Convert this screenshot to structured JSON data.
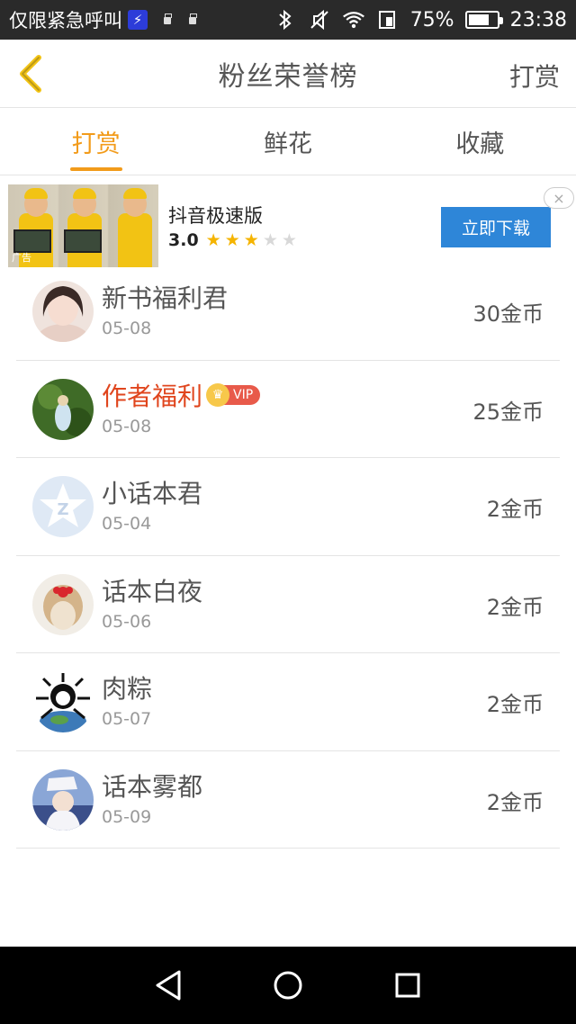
{
  "status_bar": {
    "carrier": "仅限紧急呼叫",
    "battery_percent": "75%",
    "battery_level": 0.75,
    "time": "23:38",
    "icons": [
      "lightning-icon",
      "usb-icon",
      "usb-icon",
      "bluetooth-icon",
      "mute-icon",
      "wifi-icon",
      "sim-icon",
      "battery-icon"
    ]
  },
  "header": {
    "title": "粉丝荣誉榜",
    "right_action": "打赏",
    "back_icon": "chevron-left-icon",
    "accent_color": "#f29b1a"
  },
  "tabs": [
    {
      "label": "打赏",
      "active": true
    },
    {
      "label": "鲜花",
      "active": false
    },
    {
      "label": "收藏",
      "active": false
    }
  ],
  "ad": {
    "app_name": "抖音极速版",
    "rating": "3.0",
    "stars_filled": 3,
    "stars_total": 5,
    "thumb_tag": "广告",
    "cta": "立即下载",
    "close": "×",
    "cta_color": "#2e86d8"
  },
  "list": [
    {
      "name": "新书福利君",
      "date": "05-08",
      "amount": "30金币",
      "highlight": false,
      "vip": false
    },
    {
      "name": "作者福利",
      "date": "05-08",
      "amount": "25金币",
      "highlight": true,
      "vip": true,
      "vip_label": "VIP"
    },
    {
      "name": "小话本君",
      "date": "05-04",
      "amount": "2金币",
      "highlight": false,
      "vip": false
    },
    {
      "name": "话本白夜",
      "date": "05-06",
      "amount": "2金币",
      "highlight": false,
      "vip": false
    },
    {
      "name": "肉粽",
      "date": "05-07",
      "amount": "2金币",
      "highlight": false,
      "vip": false
    },
    {
      "name": "话本雾都",
      "date": "05-09",
      "amount": "2金币",
      "highlight": false,
      "vip": false
    }
  ],
  "nav_bar": {
    "icons": [
      "back-triangle-icon",
      "home-circle-icon",
      "recents-square-icon"
    ]
  }
}
